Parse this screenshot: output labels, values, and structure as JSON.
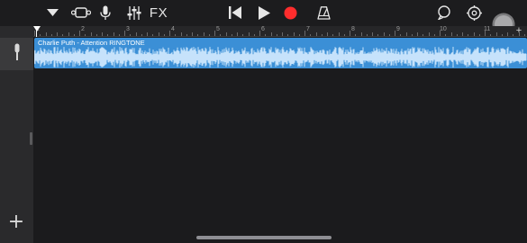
{
  "toolbar": {
    "fx_label": "FX",
    "record_color": "#ff2d2d",
    "icons": {
      "browser": "dropdown-triangle-icon",
      "view": "smart-controls-icon",
      "instrument": "microphone-icon",
      "mixer": "mixer-sliders-icon",
      "rewind": "go-to-beginning-icon",
      "play": "play-icon",
      "record": "record-icon",
      "metronome": "metronome-icon",
      "loop": "loop-browser-icon",
      "settings": "settings-gear-icon",
      "master": "master-volume-knob-icon"
    }
  },
  "ruler": {
    "bars": [
      "1",
      "2",
      "3",
      "4",
      "5",
      "6",
      "7",
      "8",
      "9",
      "10",
      "11"
    ],
    "add_section_label": "+"
  },
  "track_column": {
    "add_track_label": "+",
    "track_icon": "microphone-icon"
  },
  "region": {
    "name": "Charlie Puth - Attention RINGTONE",
    "color": "#3b8fd6"
  }
}
